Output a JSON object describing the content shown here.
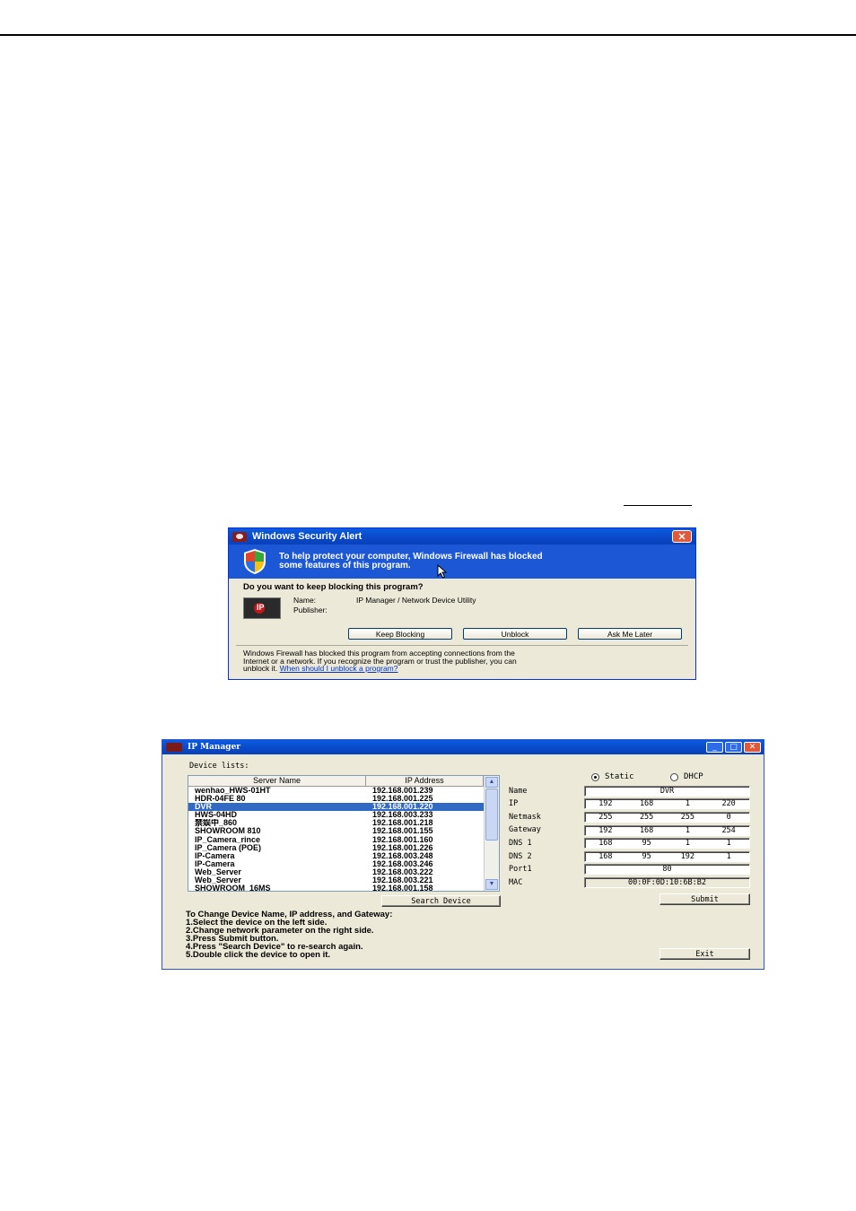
{
  "security_alert": {
    "title": "Windows Security Alert",
    "banner_line1": "To help protect your computer,  Windows Firewall has blocked",
    "banner_line2": "some features of this program.",
    "question": "Do you want to keep blocking this program?",
    "name_label": "Name:",
    "name_value": "IP Manager / Network Device Utility",
    "publisher_label": "Publisher:",
    "buttons": {
      "keep_blocking": "Keep Blocking",
      "unblock": "Unblock",
      "ask_later": "Ask Me Later"
    },
    "footer_line1": "Windows Firewall has blocked this program from accepting connections from the",
    "footer_line2": "Internet or a network. If you recognize the program or trust the publisher, you can",
    "footer_line3_prefix": "unblock it.",
    "footer_link": "When should I unblock a program?",
    "close_glyph": "✕"
  },
  "ip_manager": {
    "title": "IP Manager",
    "device_lists_label": "Device lists:",
    "columns": {
      "server_name": "Server Name",
      "ip_address": "IP Address"
    },
    "devices": [
      {
        "name": "wenhao_HWS-01HT",
        "ip": "192.168.001.239"
      },
      {
        "name": "HDR-04FE        80",
        "ip": "192.168.001.225"
      },
      {
        "name": "DVR",
        "ip": "192.168.001.220",
        "selected": true
      },
      {
        "name": "HWS-04HD",
        "ip": "192.168.003.233"
      },
      {
        "name": "禁娱中_860",
        "ip": "192.168.001.218"
      },
      {
        "name": "SHOWROOM 810",
        "ip": "192.168.001.155"
      },
      {
        "name": "IP_Camera_rince",
        "ip": "192.168.001.160"
      },
      {
        "name": "IP_Camera (POE)",
        "ip": "192.168.001.226"
      },
      {
        "name": "IP-Camera",
        "ip": "192.168.003.248"
      },
      {
        "name": "IP-Camera",
        "ip": "192.168.003.246"
      },
      {
        "name": "Web_Server",
        "ip": "192.168.003.222"
      },
      {
        "name": "Web_Server",
        "ip": "192.168.003.221"
      },
      {
        "name": "SHOWROOM_16MS",
        "ip": "192.168.001.158"
      }
    ],
    "search_button": "Search Device",
    "static_label": "Static",
    "dhcp_label": "DHCP",
    "static_selected": true,
    "fields": {
      "name": {
        "label": "Name",
        "value": "DVR"
      },
      "ip": {
        "label": "IP",
        "octets": [
          "192",
          "168",
          "1",
          "220"
        ]
      },
      "netmask": {
        "label": "Netmask",
        "octets": [
          "255",
          "255",
          "255",
          "0"
        ]
      },
      "gateway": {
        "label": "Gateway",
        "octets": [
          "192",
          "168",
          "1",
          "254"
        ]
      },
      "dns1": {
        "label": "DNS 1",
        "octets": [
          "168",
          "95",
          "1",
          "1"
        ]
      },
      "dns2": {
        "label": "DNS 2",
        "octets": [
          "168",
          "95",
          "192",
          "1"
        ]
      },
      "port": {
        "label": "Port1",
        "value": "80"
      },
      "mac": {
        "label": "MAC",
        "value": "00:0F:0D:10:6B:B2"
      }
    },
    "submit_button": "Submit",
    "exit_button": "Exit",
    "instructions": [
      "To Change Device Name, IP address, and Gateway:",
      "1.Select the device on the left side.",
      "2.Change network parameter on the right side.",
      "3.Press Submit button.",
      "4.Press  \"Search Device\"  to re-search again.",
      "5.Double click the device to open it."
    ]
  }
}
